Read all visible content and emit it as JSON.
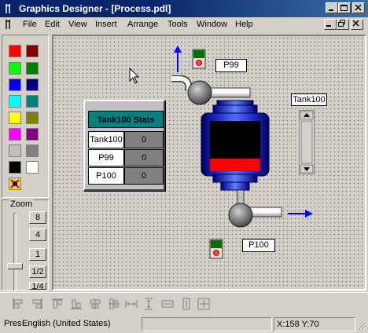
{
  "window": {
    "title": "Graphics Designer - [Process.pdl]"
  },
  "menu": [
    "File",
    "Edit",
    "View",
    "Insert",
    "Arrange",
    "Tools",
    "Window",
    "Help"
  ],
  "palette": {
    "colors": [
      "#ff0000",
      "#800000",
      "#00ff00",
      "#008000",
      "#0000ff",
      "#000080",
      "#00ffff",
      "#008080",
      "#ffff00",
      "#808000",
      "#ff00ff",
      "#800080",
      "#c0c0c0",
      "#808080",
      "#000000",
      "#ffffff"
    ]
  },
  "zoom": {
    "label": "Zoom",
    "levels": [
      "8",
      "4",
      "1",
      "1/2",
      "1/4"
    ]
  },
  "canvas": {
    "stats_title": "Tank100 Stats",
    "stats_rows": [
      {
        "label": "Tank100",
        "value": "0"
      },
      {
        "label": "P99",
        "value": "0"
      },
      {
        "label": "P100",
        "value": "0"
      }
    ],
    "pump_top_label": "P99",
    "pump_bottom_label": "P100",
    "tank_label": "Tank100",
    "tank_level": 0.25
  },
  "status": {
    "hint": "Pres",
    "language": "English (United States)",
    "coordinates": "X:158 Y:70"
  }
}
